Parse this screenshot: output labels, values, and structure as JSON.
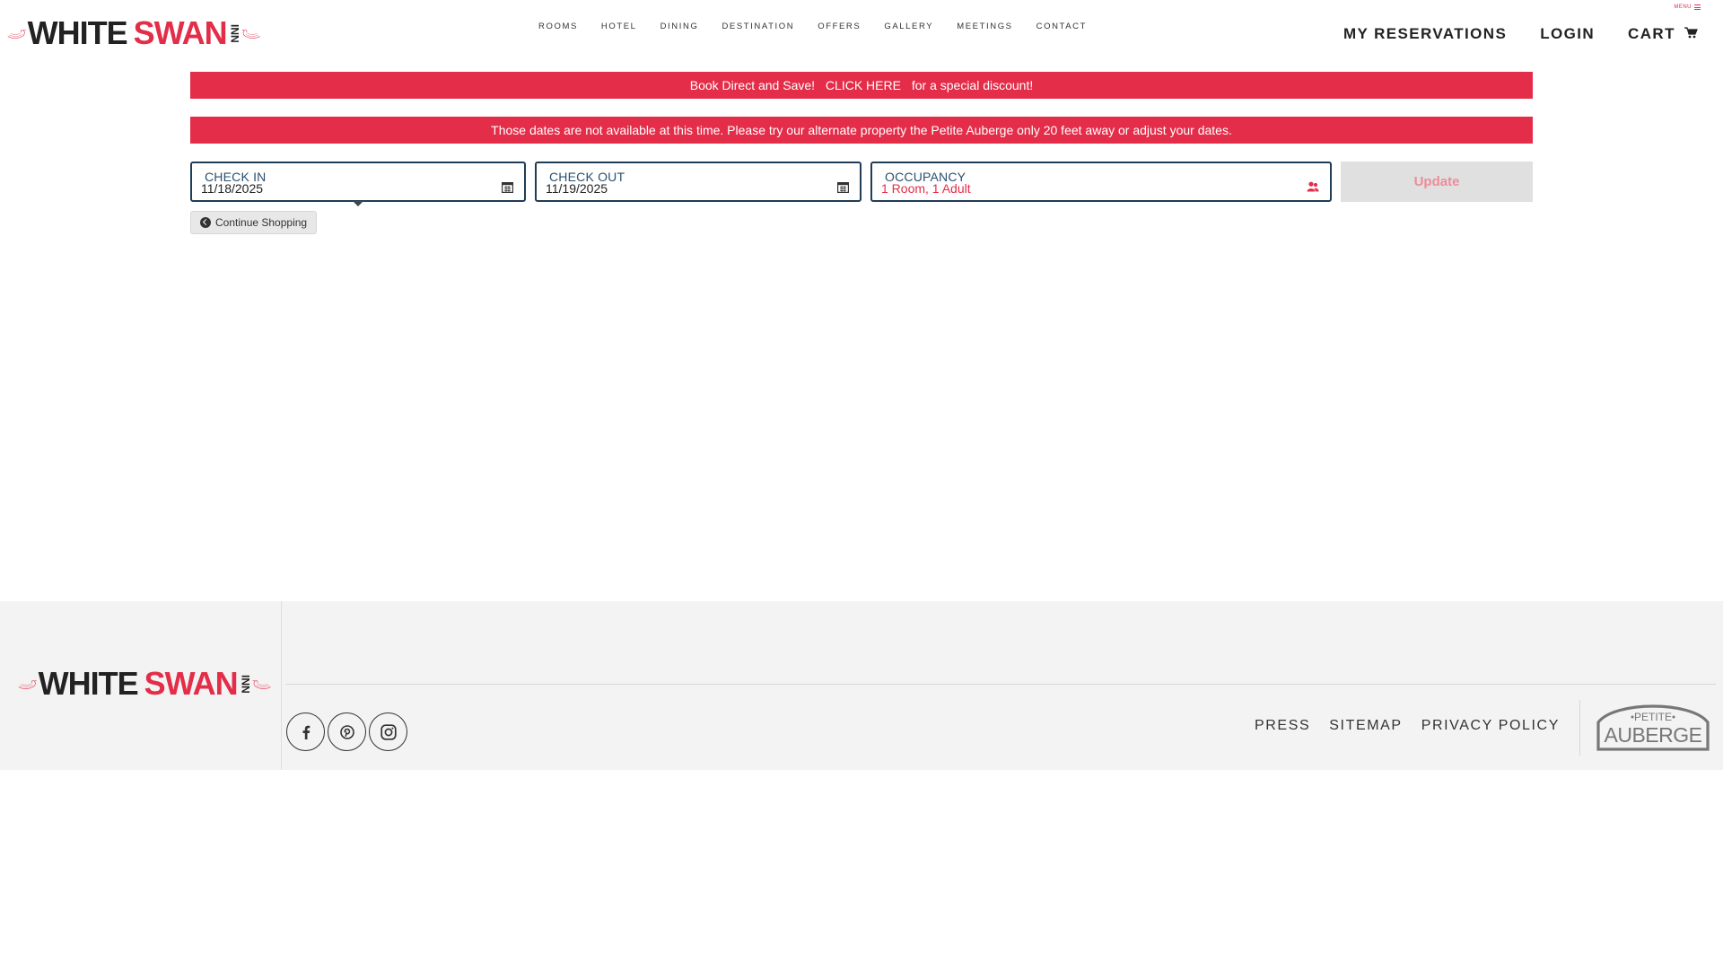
{
  "brand": {
    "word1": "WHITE",
    "word2": "SWAN",
    "word3": "INN"
  },
  "nav": {
    "items": [
      "ROOMS",
      "HOTEL",
      "DINING",
      "DESTINATION",
      "OFFERS",
      "GALLERY",
      "MEETINGS",
      "CONTACT"
    ],
    "menu_label": "MENU"
  },
  "account": {
    "reservations": "MY RESERVATIONS",
    "login": "LOGIN",
    "cart": "CART"
  },
  "promo": {
    "lead": "Book Direct and Save!",
    "cta": "CLICK HERE",
    "tail": "for a special discount!"
  },
  "alert": {
    "message": "Those dates are not available at this time. Please try our alternate property the Petite Auberge only 20 feet away or adjust your dates."
  },
  "booking": {
    "checkin_label": "CHECK IN",
    "checkin_value": "11/18/2025",
    "checkout_label": "CHECK OUT",
    "checkout_value": "11/19/2025",
    "occupancy_label": "OCCUPANCY",
    "occupancy_value": "1 Room, 1 Adult",
    "update_label": "Update",
    "continue_label": "Continue Shopping"
  },
  "footer": {
    "links": [
      "PRESS",
      "SITEMAP",
      "PRIVACY POLICY"
    ],
    "partner": {
      "small": "PETITE",
      "large": "AUBERGE"
    }
  },
  "colors": {
    "accent": "#e32d49",
    "navy": "#1f3d57",
    "footer_bg": "#f3f3f3"
  },
  "icons": [
    "calendar-icon",
    "users-icon",
    "cart-icon",
    "chevron-left-icon",
    "facebook-icon",
    "pinterest-icon",
    "instagram-icon"
  ]
}
